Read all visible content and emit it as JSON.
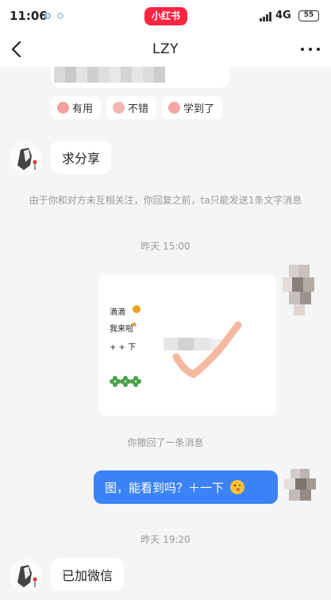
{
  "status_bar": {
    "time": "11:06",
    "app_name": "小红书",
    "network": "4G",
    "battery": "55"
  },
  "header": {
    "title": "LZY"
  },
  "chips": [
    {
      "label": "有用",
      "icon": "sticker-face-icon"
    },
    {
      "label": "不错",
      "icon": "sticker-face-icon"
    },
    {
      "label": "学到了",
      "icon": "sticker-face-icon"
    }
  ],
  "messages": {
    "incoming_1": "求分享",
    "system_note": "由于你和对方未互相关注，你回复之前，ta只能发送1条文字消息",
    "time_1": "昨天 15:00",
    "image_lines": [
      "滴滴",
      "我来啦",
      "+ + 下"
    ],
    "recalled": "你撤回了一条消息",
    "outgoing_1": "图，能看到吗？＋一下",
    "time_2": "昨天 19:20",
    "incoming_2": "已加微信"
  },
  "colors": {
    "accent": "#3b82f6",
    "brand": "#ff2442",
    "background": "#f5f5f5"
  }
}
